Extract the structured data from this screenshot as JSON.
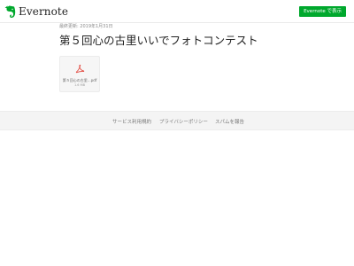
{
  "header": {
    "logo_text": "Evernote",
    "open_button_label": "Evernote で表示"
  },
  "note": {
    "meta": "最終更新: 2019年1月31日",
    "title": "第５回心の古里いいでフォトコンテスト",
    "attachment": {
      "name": "第５回心の古里…pdf",
      "size": "1.6 MB",
      "icon": "pdf-icon"
    }
  },
  "footer": {
    "links": [
      "サービス利用規約",
      "プライバシーポリシー",
      "スパムを報告"
    ]
  },
  "colors": {
    "brand_green": "#00a82d",
    "pdf_red": "#e2463c"
  }
}
